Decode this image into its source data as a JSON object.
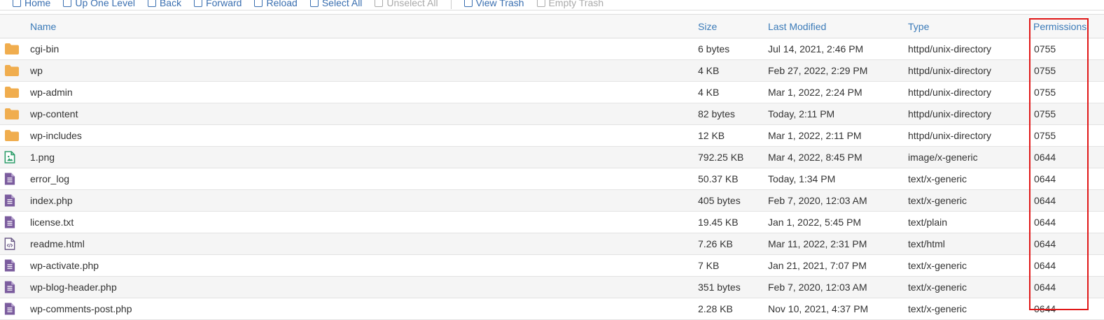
{
  "toolbar": {
    "items": [
      {
        "label": "Home",
        "icon": "home-icon",
        "enabled": true
      },
      {
        "label": "Up One Level",
        "icon": "level-up-icon",
        "enabled": true
      },
      {
        "label": "Back",
        "icon": "arrow-left-icon",
        "enabled": true
      },
      {
        "label": "Forward",
        "icon": "arrow-right-icon",
        "enabled": true
      },
      {
        "label": "Reload",
        "icon": "reload-icon",
        "enabled": true
      },
      {
        "label": "Select All",
        "icon": "checkbox-checked-icon",
        "enabled": true
      },
      {
        "label": "Unselect All",
        "icon": "checkbox-empty-icon",
        "enabled": false
      },
      {
        "label": "View Trash",
        "icon": "trash-icon",
        "enabled": true
      },
      {
        "label": "Empty Trash",
        "icon": "trash-icon",
        "enabled": false
      }
    ]
  },
  "table": {
    "headers": {
      "name": "Name",
      "size": "Size",
      "modified": "Last Modified",
      "type": "Type",
      "permissions": "Permissions"
    },
    "rows": [
      {
        "icon": "folder-icon",
        "name": "cgi-bin",
        "size": "6 bytes",
        "modified": "Jul 14, 2021, 2:46 PM",
        "type": "httpd/unix-directory",
        "perm": "0755"
      },
      {
        "icon": "folder-icon",
        "name": "wp",
        "size": "4 KB",
        "modified": "Feb 27, 2022, 2:29 PM",
        "type": "httpd/unix-directory",
        "perm": "0755"
      },
      {
        "icon": "folder-icon",
        "name": "wp-admin",
        "size": "4 KB",
        "modified": "Mar 1, 2022, 2:24 PM",
        "type": "httpd/unix-directory",
        "perm": "0755"
      },
      {
        "icon": "folder-icon",
        "name": "wp-content",
        "size": "82 bytes",
        "modified": "Today, 2:11 PM",
        "type": "httpd/unix-directory",
        "perm": "0755"
      },
      {
        "icon": "folder-icon",
        "name": "wp-includes",
        "size": "12 KB",
        "modified": "Mar 1, 2022, 2:11 PM",
        "type": "httpd/unix-directory",
        "perm": "0755"
      },
      {
        "icon": "image-file-icon",
        "name": "1.png",
        "size": "792.25 KB",
        "modified": "Mar 4, 2022, 8:45 PM",
        "type": "image/x-generic",
        "perm": "0644"
      },
      {
        "icon": "text-file-icon",
        "name": "error_log",
        "size": "50.37 KB",
        "modified": "Today, 1:34 PM",
        "type": "text/x-generic",
        "perm": "0644"
      },
      {
        "icon": "text-file-icon",
        "name": "index.php",
        "size": "405 bytes",
        "modified": "Feb 7, 2020, 12:03 AM",
        "type": "text/x-generic",
        "perm": "0644"
      },
      {
        "icon": "text-file-icon",
        "name": "license.txt",
        "size": "19.45 KB",
        "modified": "Jan 1, 2022, 5:45 PM",
        "type": "text/plain",
        "perm": "0644"
      },
      {
        "icon": "code-file-icon",
        "name": "readme.html",
        "size": "7.26 KB",
        "modified": "Mar 11, 2022, 2:31 PM",
        "type": "text/html",
        "perm": "0644"
      },
      {
        "icon": "text-file-icon",
        "name": "wp-activate.php",
        "size": "7 KB",
        "modified": "Jan 21, 2021, 7:07 PM",
        "type": "text/x-generic",
        "perm": "0644"
      },
      {
        "icon": "text-file-icon",
        "name": "wp-blog-header.php",
        "size": "351 bytes",
        "modified": "Feb 7, 2020, 12:03 AM",
        "type": "text/x-generic",
        "perm": "0644"
      },
      {
        "icon": "text-file-icon",
        "name": "wp-comments-post.php",
        "size": "2.28 KB",
        "modified": "Nov 10, 2021, 4:37 PM",
        "type": "text/x-generic",
        "perm": "0644"
      }
    ]
  },
  "colors": {
    "folder": "#f0ad4e",
    "image_file": "#2e9e6b",
    "text_file": "#7b5c9e",
    "link": "#3a7ab8",
    "highlight": "#e01818"
  }
}
